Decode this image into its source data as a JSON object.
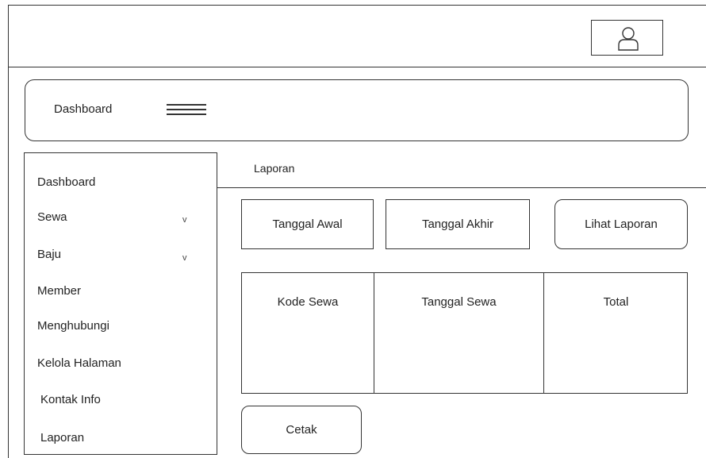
{
  "header": {
    "profile_icon": "user-icon"
  },
  "dashboard_bar": {
    "title": "Dashboard",
    "menu_icon": "hamburger-icon"
  },
  "sidebar": {
    "items": [
      {
        "label": "Dashboard"
      },
      {
        "label": "Sewa",
        "caret": "v"
      },
      {
        "label": "Baju",
        "caret": "v"
      },
      {
        "label": "Member"
      },
      {
        "label": "Menghubungi"
      },
      {
        "label": "Kelola Halaman"
      },
      {
        "label": "Kontak Info"
      },
      {
        "label": "Laporan"
      }
    ]
  },
  "content": {
    "section_title": "Laporan",
    "start_date_label": "Tanggal Awal",
    "end_date_label": "Tanggal Akhir",
    "view_report_label": "Lihat Laporan",
    "print_label": "Cetak",
    "table": {
      "columns": [
        "Kode Sewa",
        "Tanggal Sewa",
        "Total"
      ]
    }
  }
}
